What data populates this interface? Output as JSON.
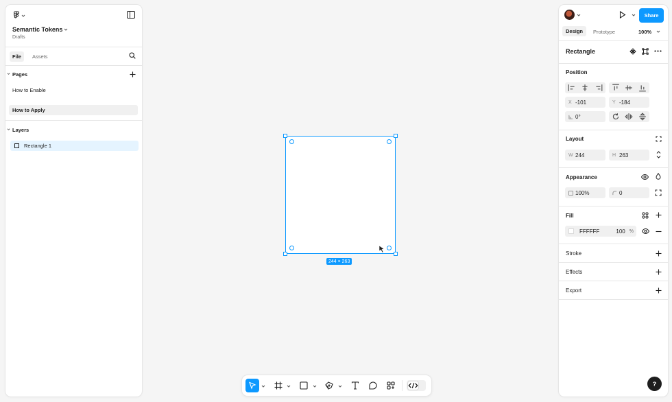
{
  "left": {
    "file_name": "Semantic Tokens",
    "location": "Drafts",
    "tabs": [
      "File",
      "Assets"
    ],
    "pages_title": "Pages",
    "pages": [
      "How to Enable",
      "How to Apply"
    ],
    "layers_title": "Layers",
    "layers": [
      "Rectangle 1"
    ]
  },
  "canvas": {
    "size_label": "244 × 263",
    "selection_color": "#0d99ff"
  },
  "right": {
    "share_label": "Share",
    "tabs": [
      "Design",
      "Prototype"
    ],
    "zoom": "100%",
    "selection_title": "Rectangle",
    "position": {
      "title": "Position",
      "x_label": "X",
      "x": "-101",
      "y_label": "Y",
      "y": "-184",
      "rotation": "0°"
    },
    "layout": {
      "title": "Layout",
      "w_label": "W",
      "w": "244",
      "h_label": "H",
      "h": "263"
    },
    "appearance": {
      "title": "Appearance",
      "opacity": "100%",
      "radius": "0"
    },
    "fill": {
      "title": "Fill",
      "hex": "FFFFFF",
      "opacity": "100",
      "percent": "%"
    },
    "stroke_title": "Stroke",
    "effects_title": "Effects",
    "export_title": "Export"
  },
  "help_label": "?",
  "accent": "#0d99ff",
  "icons": [
    "figma-menu-icon",
    "sidebar-toggle-icon",
    "search-icon",
    "plus-icon",
    "play-icon",
    "component-icon",
    "more-icon",
    "move-tool-icon",
    "frame-tool-icon",
    "rectangle-tool-icon",
    "pen-tool-icon",
    "text-tool-icon",
    "comment-tool-icon",
    "actions-icon",
    "dev-mode-icon"
  ]
}
